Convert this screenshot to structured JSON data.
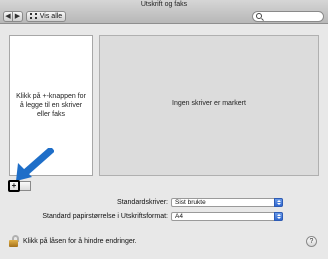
{
  "window": {
    "title": "Utskrift og faks"
  },
  "toolbar": {
    "back_glyph": "◀",
    "forward_glyph": "▶",
    "show_all_label": "Vis alle",
    "search_placeholder": ""
  },
  "printer_list": {
    "hint": "Klikk på +-knappen for å legge til en skriver eller faks"
  },
  "detail": {
    "message": "Ingen skriver er markert"
  },
  "list_controls": {
    "add_glyph": "+",
    "remove_glyph": ""
  },
  "settings": {
    "default_printer_label": "Standardskriver:",
    "default_printer_value": "Sist brukte",
    "paper_size_label": "Standard papirstørrelse i Utskriftsformat:",
    "paper_size_value": "A4"
  },
  "footer": {
    "lock_text": "Klikk på låsen for å hindre endringer.",
    "help_glyph": "?"
  },
  "colors": {
    "arrow": "#1e6ec8",
    "stepper": "#2f67d0"
  }
}
